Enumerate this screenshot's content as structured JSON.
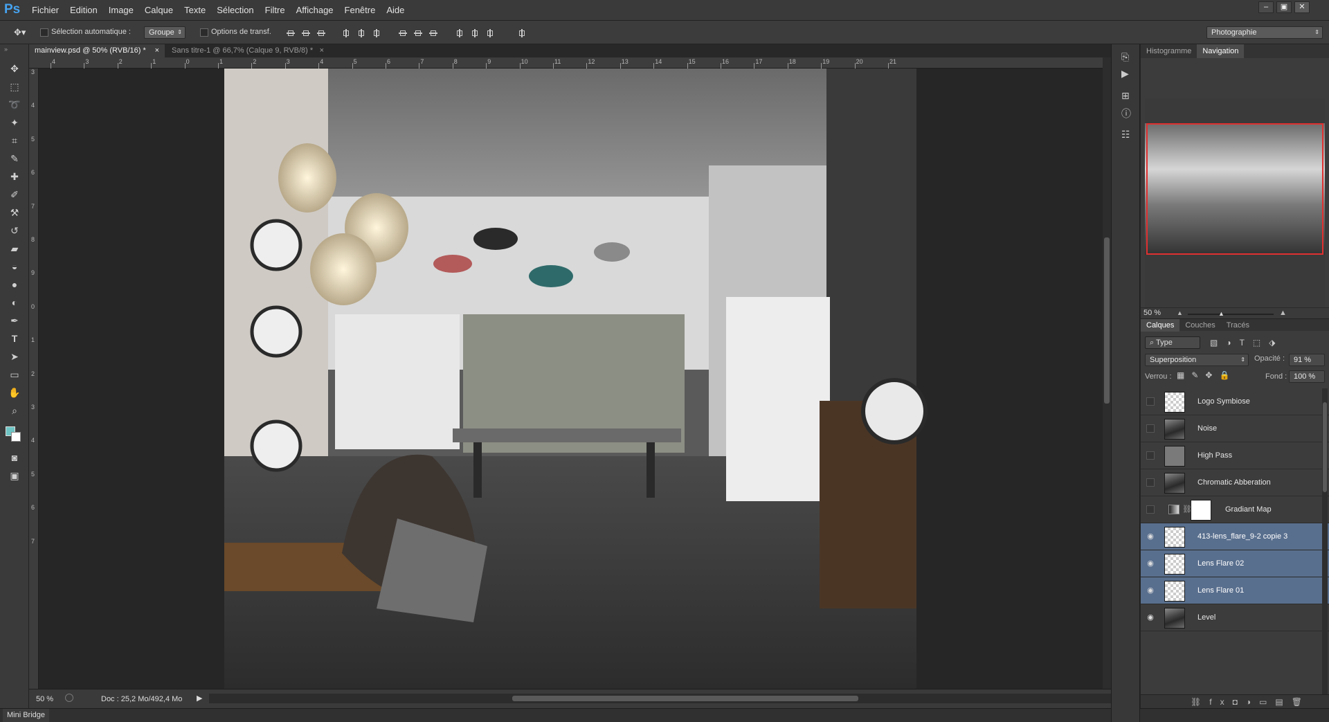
{
  "app": {
    "logo": "Ps"
  },
  "menu": [
    "Fichier",
    "Edition",
    "Image",
    "Calque",
    "Texte",
    "Sélection",
    "Filtre",
    "Affichage",
    "Fenêtre",
    "Aide"
  ],
  "window_buttons": [
    "–",
    "▣",
    "✕"
  ],
  "options": {
    "auto_select_label": "Sélection automatique :",
    "auto_select_value": "Groupe",
    "transform_label": "Options de transf.",
    "workspace": "Photographie"
  },
  "tabs": [
    {
      "label": "mainview.psd @ 50% (RVB/16) *",
      "close": "×"
    },
    {
      "label": "Sans titre-1 @ 66,7% (Calque 9, RVB/8) *",
      "close": "×"
    }
  ],
  "ruler_top": [
    "4",
    "3",
    "2",
    "1",
    "0",
    "1",
    "2",
    "3",
    "4",
    "5",
    "6",
    "7",
    "8",
    "9",
    "10",
    "11",
    "12",
    "13",
    "14",
    "15",
    "16",
    "17",
    "18",
    "19",
    "20",
    "21"
  ],
  "ruler_left": [
    "3",
    "4",
    "5",
    "6",
    "7",
    "8",
    "9",
    "0",
    "1",
    "2",
    "3",
    "4",
    "5",
    "6",
    "7"
  ],
  "status": {
    "zoom": "50 %",
    "doc": "Doc : 25,2 Mo/492,4 Mo"
  },
  "minibridge": "Mini Bridge",
  "panels": {
    "top_tabs": [
      "Histogramme",
      "Navigation"
    ],
    "nav_zoom": "50 %",
    "layer_tabs": [
      "Calques",
      "Couches",
      "Tracés"
    ],
    "filter_label": "Type",
    "blend_mode": "Superposition",
    "opacity_label": "Opacité :",
    "opacity_value": "91 %",
    "lock_label": "Verrou :",
    "fill_label": "Fond :",
    "fill_value": "100 %"
  },
  "layers": [
    {
      "name": "Logo Symbiose",
      "visible": false,
      "selected": false,
      "thumb": "checker"
    },
    {
      "name": "Noise",
      "visible": false,
      "selected": false,
      "thumb": "photo"
    },
    {
      "name": "High Pass",
      "visible": false,
      "selected": false,
      "thumb": "gray"
    },
    {
      "name": "Chromatic Abberation",
      "visible": false,
      "selected": false,
      "thumb": "photo"
    },
    {
      "name": "Gradiant Map",
      "visible": false,
      "selected": false,
      "thumb": "adjust"
    },
    {
      "name": "413-lens_flare_9-2 copie 3",
      "visible": true,
      "selected": true,
      "thumb": "checker"
    },
    {
      "name": "Lens Flare 02",
      "visible": true,
      "selected": true,
      "thumb": "checker"
    },
    {
      "name": "Lens Flare 01",
      "visible": true,
      "selected": true,
      "thumb": "checker"
    },
    {
      "name": "Level",
      "visible": true,
      "selected": false,
      "thumb": "photo"
    }
  ],
  "colors": {
    "accent": "#46a3f0",
    "selected_layer": "#596f8e",
    "nav_frame": "#e03030",
    "foreground": "#6fc4c4",
    "background": "#ffffff"
  }
}
